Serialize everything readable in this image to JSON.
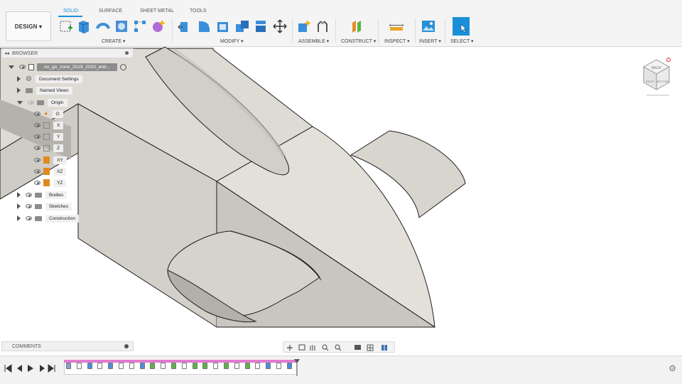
{
  "toolbar": {
    "design_label": "DESIGN ▾",
    "tabs": [
      "SOLID",
      "SURFACE",
      "SHEET METAL",
      "TOOLS"
    ],
    "groups": [
      "CREATE ▾",
      "MODIFY ▾",
      "ASSEMBLE ▾",
      "CONSTRUCT ▾",
      "INSPECT ▾",
      "INSERT ▾",
      "SELECT ▾"
    ]
  },
  "browser": {
    "title": "BROWSER",
    "root": "no_go_zone_2019_2020_entr...",
    "items": [
      "Document Settings",
      "Named Views",
      "Origin"
    ],
    "origin_items": [
      "O",
      "X",
      "Y",
      "Z",
      "XY",
      "XZ",
      "YZ"
    ],
    "bottom_items": [
      "Bodies",
      "Sketches",
      "Construction"
    ]
  },
  "comments": {
    "label": "COMMENTS"
  },
  "viewcube": {
    "faces": [
      "BACK",
      "RIGHT",
      "BOTTOM"
    ]
  },
  "colors": {
    "accent": "#1a8fd8",
    "model_light": "#dedbd5",
    "model_mid": "#cfccc5",
    "model_dark": "#a9a6a0",
    "timeline_pink": "#e07bd0"
  }
}
